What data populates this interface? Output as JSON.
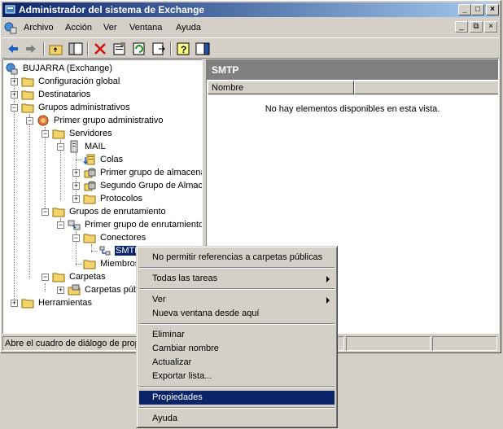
{
  "window": {
    "title": "Administrador del sistema de Exchange",
    "controls": {
      "minimize": "_",
      "maximize": "□",
      "close": "×"
    }
  },
  "menubar": {
    "items": [
      "Archivo",
      "Acción",
      "Ver",
      "Ventana",
      "Ayuda"
    ],
    "mdi_controls": {
      "minimize": "_",
      "restore": "⧉",
      "close": "×"
    }
  },
  "toolbar": {
    "buttons": [
      "back-icon",
      "forward-icon",
      "up-folder-icon",
      "show-hide-tree-icon",
      "delete-icon",
      "properties-icon",
      "refresh-icon",
      "export-list-icon",
      "help-icon",
      "show-hide-action-pane-icon"
    ]
  },
  "tree": {
    "root": "BUJARRA (Exchange)",
    "configuracion_global": "Configuración global",
    "destinatarios": "Destinatarios",
    "grupos_administrativos": "Grupos administrativos",
    "primer_grupo_administrativo": "Primer grupo administrativo",
    "servidores": "Servidores",
    "mail": "MAIL",
    "colas": "Colas",
    "primer_grupo_almacen": "Primer grupo de almacena",
    "segundo_grupo_almacen": "Segundo Grupo de Almace",
    "protocolos": "Protocolos",
    "grupos_enrutamiento": "Grupos de enrutamiento",
    "primer_grupo_enrutamiento": "Primer grupo de enrutamiento",
    "conectores": "Conectores",
    "smtp": "SMTP",
    "miembros": "Miembros",
    "carpetas": "Carpetas",
    "carpetas_publicas": "Carpetas públ",
    "herramientas": "Herramientas"
  },
  "right_pane": {
    "header": "SMTP",
    "column_name": "Nombre",
    "empty_message": "No hay elementos disponibles en esta vista."
  },
  "statusbar": {
    "text": "Abre el cuadro de diálogo de propi"
  },
  "context_menu": {
    "items": [
      {
        "label": "No permitir referencias a carpetas públicas"
      },
      {
        "label": "Todas las tareas"
      },
      {
        "label": "Ver"
      },
      {
        "label": "Nueva ventana desde aquí"
      },
      {
        "label": "Eliminar"
      },
      {
        "label": "Cambiar nombre"
      },
      {
        "label": "Actualizar"
      },
      {
        "label": "Exportar lista..."
      },
      {
        "label": "Propiedades"
      },
      {
        "label": "Ayuda"
      }
    ],
    "highlighted": "Propiedades"
  }
}
